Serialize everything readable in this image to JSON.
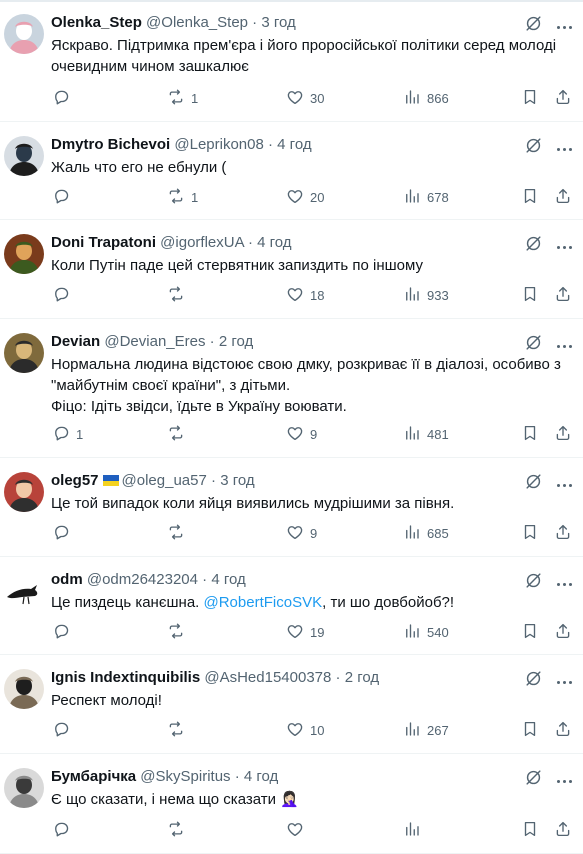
{
  "replies": [
    {
      "name": "Olenka_Step",
      "handle": "@Olenka_Step",
      "time": "3 год",
      "flag": false,
      "lines": [
        "Яскраво. Підтримка прем'єра і його проросійської політики серед молоді",
        "очевидним чином зашкалює"
      ],
      "comments": "",
      "reposts": "1",
      "likes": "30",
      "views": "866",
      "avatar": {
        "bg": "#c9d4de",
        "fg": "#ffffff",
        "accent": "#e8a0b0",
        "icon": "photo-avatar"
      }
    },
    {
      "name": "Dmytro Bichevoi",
      "handle": "@Leprikon08",
      "time": "4 год",
      "flag": false,
      "lines": [
        "Жаль что его не ебнули ("
      ],
      "comments": "",
      "reposts": "1",
      "likes": "20",
      "views": "678",
      "avatar": {
        "bg": "#d7dde3",
        "fg": "#2b3a4a",
        "accent": "#1d1d1d",
        "icon": "photo-avatar"
      }
    },
    {
      "name": "Doni Trapatoni",
      "handle": "@igorflexUA",
      "time": "4 год",
      "flag": false,
      "lines": [
        "Коли Путін паде цей стервятник  запиздить по іншому"
      ],
      "comments": "",
      "reposts": "",
      "likes": "18",
      "views": "933",
      "avatar": {
        "bg": "#7a3b1c",
        "fg": "#e0a35a",
        "accent": "#3c5a1f",
        "icon": "photo-avatar"
      }
    },
    {
      "name": "Devian",
      "handle": "@Devian_Eres",
      "time": "2 год",
      "flag": false,
      "lines": [
        "Нормальна людина відстоює свою дмку, розкриває її в діалозі, особиво з",
        "\"майбутнім своєї країни\", з дітьми.",
        "Фіцо: Ідіть звідси, їдьте в Україну воювати."
      ],
      "comments": "1",
      "reposts": "",
      "likes": "9",
      "views": "481",
      "avatar": {
        "bg": "#7f6a3c",
        "fg": "#d9b77a",
        "accent": "#2b2b2b",
        "icon": "photo-avatar"
      }
    },
    {
      "name": "oleg57",
      "handle": "@oleg_ua57",
      "time": "3 год",
      "flag": true,
      "lines": [
        "Це той випадок коли яйця виявились мудрішими за півня."
      ],
      "comments": "",
      "reposts": "",
      "likes": "9",
      "views": "685",
      "avatar": {
        "bg": "#b8433a",
        "fg": "#f1c9a8",
        "accent": "#2f2f2f",
        "icon": "photo-avatar"
      }
    },
    {
      "name": "odm",
      "handle": "@odm26423204",
      "time": "4 год",
      "flag": false,
      "lines_rich": [
        [
          {
            "t": "Це пиздець канєшна. "
          },
          {
            "t": "@RobertFicoSVK",
            "m": true
          },
          {
            "t": ", ти шо довбойоб?!"
          }
        ]
      ],
      "comments": "",
      "reposts": "",
      "likes": "19",
      "views": "540",
      "avatar": {
        "bg": "#ffffff",
        "fg": "#1a1a1a",
        "accent": "#1a1a1a",
        "icon": "bird-avatar"
      }
    },
    {
      "name": "Ignis Indextinquibilis",
      "handle": "@AsHed15400378",
      "time": "2 год",
      "flag": false,
      "lines": [
        "Респект молоді!"
      ],
      "comments": "",
      "reposts": "",
      "likes": "10",
      "views": "267",
      "avatar": {
        "bg": "#e9e4dc",
        "fg": "#1e1e1e",
        "accent": "#7a6a55",
        "icon": "photo-avatar"
      }
    },
    {
      "name": "Бумбарічка",
      "handle": "@SkySpiritus",
      "time": "4 год",
      "flag": false,
      "lines": [
        "Є що сказати, і нема що сказати 🤦🏻‍♀️"
      ],
      "comments": "",
      "reposts": "",
      "likes": "",
      "views": "",
      "avatar": {
        "bg": "#d9d9d9",
        "fg": "#3a3a3a",
        "accent": "#8a8a8a",
        "icon": "photo-avatar"
      }
    }
  ],
  "colors": {
    "text": "#0f1419",
    "muted": "#536471",
    "link": "#1d9bf0",
    "divider": "#eff3f4"
  },
  "sep": "·"
}
